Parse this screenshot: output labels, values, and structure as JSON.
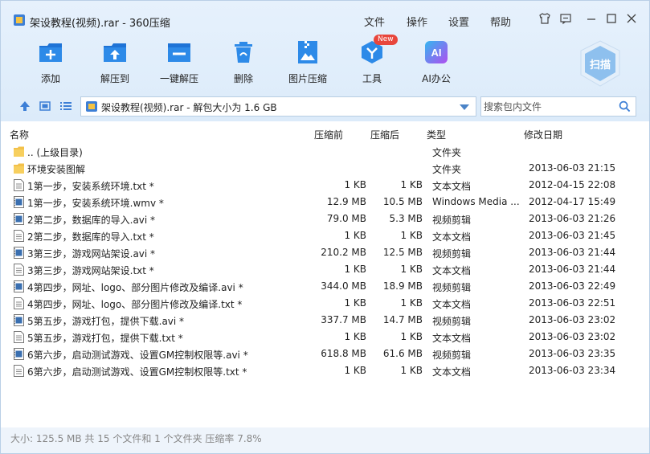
{
  "window": {
    "title": "架设教程(视频).rar - 360压缩",
    "menus": [
      "文件",
      "操作",
      "设置",
      "帮助"
    ]
  },
  "toolbar": {
    "buttons": [
      "添加",
      "解压到",
      "一键解压",
      "删除",
      "图片压缩",
      "工具",
      "AI办公"
    ],
    "new_badge": "New",
    "ai_icon_text": "AI",
    "scan_label": "扫描"
  },
  "address": {
    "path": "架设教程(视频).rar - 解包大小为 1.6 GB"
  },
  "search": {
    "placeholder": "搜索包内文件"
  },
  "columns": [
    "名称",
    "压缩前",
    "压缩后",
    "类型",
    "修改日期"
  ],
  "files": [
    {
      "name": ".. (上级目录)",
      "before": "",
      "after": "",
      "type": "文件夹",
      "date": "",
      "icon": "folder-icon"
    },
    {
      "name": "环境安装图解",
      "before": "",
      "after": "",
      "type": "文件夹",
      "date": "2013-06-03 21:15",
      "icon": "folder-icon"
    },
    {
      "name": "1第一步，安装系统环境.txt *",
      "before": "1 KB",
      "after": "1 KB",
      "type": "文本文档",
      "date": "2012-04-15 22:08",
      "icon": "text-file-icon"
    },
    {
      "name": "1第一步，安装系统环境.wmv *",
      "before": "12.9 MB",
      "after": "10.5 MB",
      "type": "Windows Media ...",
      "date": "2012-04-17 15:49",
      "icon": "video-file-icon"
    },
    {
      "name": "2第二步，数据库的导入.avi *",
      "before": "79.0 MB",
      "after": "5.3 MB",
      "type": "视频剪辑",
      "date": "2013-06-03 21:26",
      "icon": "video-file-icon"
    },
    {
      "name": "2第二步，数据库的导入.txt *",
      "before": "1 KB",
      "after": "1 KB",
      "type": "文本文档",
      "date": "2013-06-03 21:45",
      "icon": "text-file-icon"
    },
    {
      "name": "3第三步，游戏网站架设.avi *",
      "before": "210.2 MB",
      "after": "12.5 MB",
      "type": "视频剪辑",
      "date": "2013-06-03 21:44",
      "icon": "video-file-icon"
    },
    {
      "name": "3第三步，游戏网站架设.txt *",
      "before": "1 KB",
      "after": "1 KB",
      "type": "文本文档",
      "date": "2013-06-03 21:44",
      "icon": "text-file-icon"
    },
    {
      "name": "4第四步，网址、logo、部分图片修改及编译.avi *",
      "before": "344.0 MB",
      "after": "18.9 MB",
      "type": "视频剪辑",
      "date": "2013-06-03 22:49",
      "icon": "video-file-icon"
    },
    {
      "name": "4第四步，网址、logo、部分图片修改及编译.txt *",
      "before": "1 KB",
      "after": "1 KB",
      "type": "文本文档",
      "date": "2013-06-03 22:51",
      "icon": "text-file-icon"
    },
    {
      "name": "5第五步，游戏打包，提供下载.avi *",
      "before": "337.7 MB",
      "after": "14.7 MB",
      "type": "视频剪辑",
      "date": "2013-06-03 23:02",
      "icon": "video-file-icon"
    },
    {
      "name": "5第五步，游戏打包，提供下载.txt *",
      "before": "1 KB",
      "after": "1 KB",
      "type": "文本文档",
      "date": "2013-06-03 23:02",
      "icon": "text-file-icon"
    },
    {
      "name": "6第六步，启动测试游戏、设置GM控制权限等.avi *",
      "before": "618.8 MB",
      "after": "61.6 MB",
      "type": "视频剪辑",
      "date": "2013-06-03 23:35",
      "icon": "video-file-icon"
    },
    {
      "name": "6第六步，启动测试游戏、设置GM控制权限等.txt *",
      "before": "1 KB",
      "after": "1 KB",
      "type": "文本文档",
      "date": "2013-06-03 23:34",
      "icon": "text-file-icon"
    }
  ],
  "status": {
    "text": "大小: 125.5 MB 共 15 个文件和 1 个文件夹 压缩率 7.8%"
  }
}
